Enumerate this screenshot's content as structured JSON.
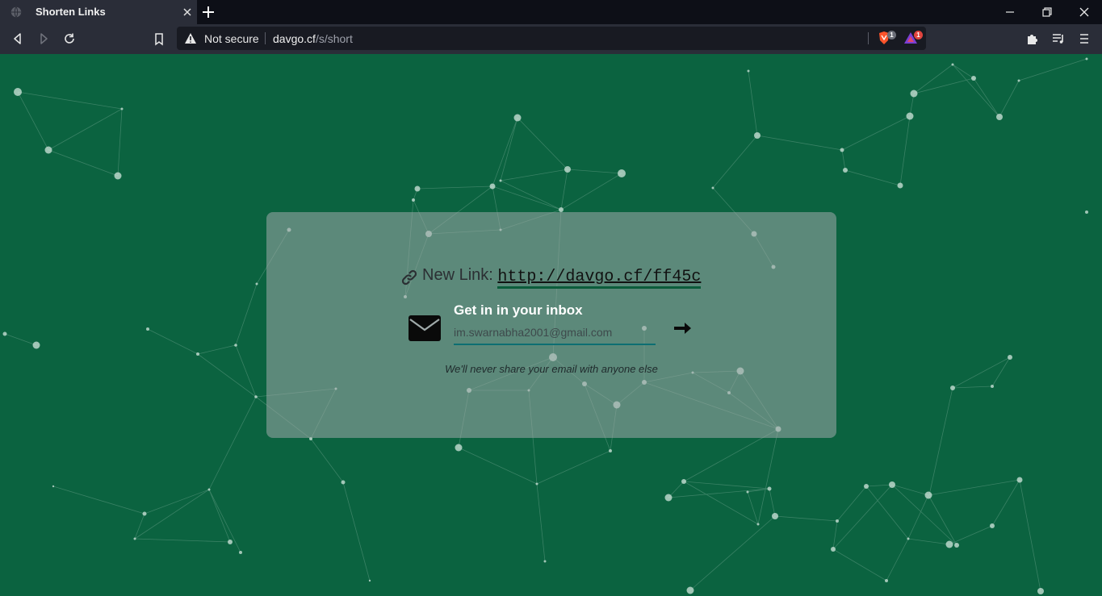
{
  "browser": {
    "tab_title": "Shorten Links",
    "url_warning": "Not secure",
    "url_host": "davgo.cf",
    "url_path": "/s/short",
    "brave_badge": "1",
    "rewards_badge": "1"
  },
  "colors": {
    "page_background": "#0b6340",
    "card_background": "rgba(160,170,170,0.55)",
    "input_underline": "#0d6e72",
    "link_underline": "#0b5c3b"
  },
  "card": {
    "new_link_label": "New Link:",
    "new_link_url": "http://davgo.cf/ff45c",
    "inbox_title": "Get in in your inbox",
    "email_value": "im.swarnabha2001@gmail.com",
    "privacy_note": "We'll never share your email with anyone else"
  },
  "icons": {
    "link": "link-icon",
    "mail": "envelope-icon",
    "submit": "arrow-right-icon"
  }
}
